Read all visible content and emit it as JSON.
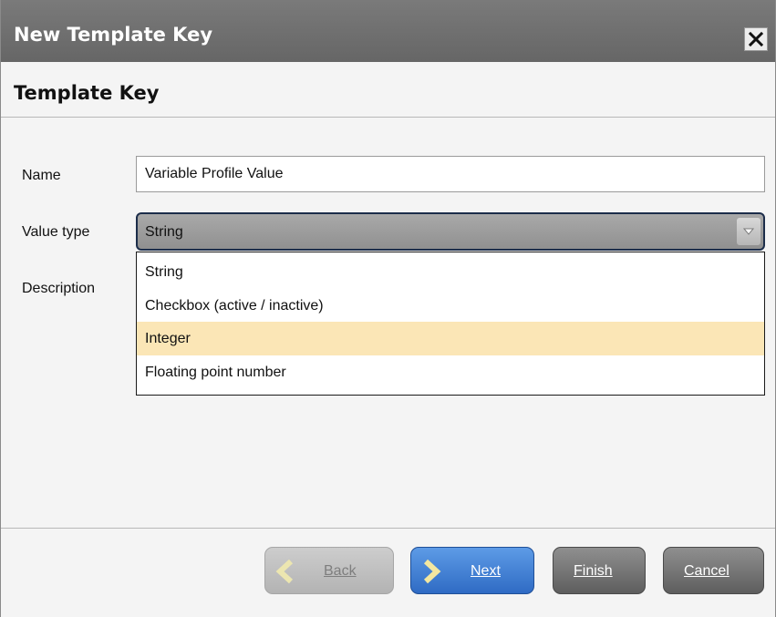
{
  "window": {
    "title": "New Template Key"
  },
  "header": {
    "section_title": "Template Key"
  },
  "form": {
    "name_label": "Name",
    "name_value": "Variable Profile Value",
    "value_type_label": "Value type",
    "value_type_selected": "String",
    "description_label": "Description"
  },
  "dropdown": {
    "options": [
      {
        "label": "String"
      },
      {
        "label": "Checkbox (active / inactive)"
      },
      {
        "label": "Integer",
        "highlighted": true
      },
      {
        "label": "Floating point number"
      }
    ]
  },
  "buttons": {
    "back": "Back",
    "next": "Next",
    "finish": "Finish",
    "cancel": "Cancel"
  },
  "colors": {
    "title_bar": "#6f6f6f",
    "highlight_option": "#fbe6b6",
    "primary_button": "#3d7fd6",
    "select_border": "#1c2d4a"
  }
}
